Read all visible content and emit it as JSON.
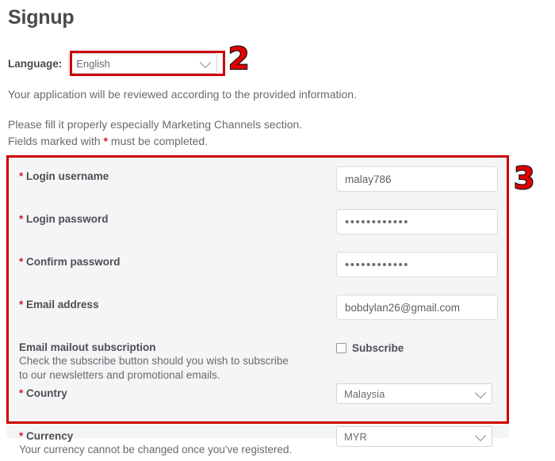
{
  "page": {
    "title": "Signup"
  },
  "language": {
    "label": "Language:",
    "value": "English"
  },
  "intro": {
    "review": "Your application will be reviewed according to the provided information.",
    "fill": "Please fill it properly especially Marketing Channels section.",
    "fields_prefix": "Fields marked with ",
    "fields_star": "*",
    "fields_suffix": " must be completed."
  },
  "annotations": {
    "step_two": "2",
    "step_three": "3",
    "color": "#cc0000"
  },
  "form": {
    "fields": [
      {
        "label": "Login username",
        "required_marker": "*",
        "value": "malay786",
        "type": "text"
      },
      {
        "label": "Login password",
        "required_marker": "*",
        "value": "••••••••••••",
        "type": "password"
      },
      {
        "label": "Confirm password",
        "required_marker": "*",
        "value": "••••••••••••",
        "type": "password"
      },
      {
        "label": "Email address",
        "required_marker": "*",
        "value": "bobdylan26@gmail.com",
        "type": "email"
      }
    ],
    "subscription": {
      "label": "Email mailout subscription",
      "note_line1": "Check the subscribe button should you wish to subscribe",
      "note_line2": "to our newsletters and promotional emails.",
      "checkbox_label": "Subscribe",
      "checked": false
    },
    "country": {
      "label": "Country",
      "required_marker": "*",
      "value": "Malaysia"
    },
    "currency": {
      "label": "Currency",
      "required_marker": "*",
      "note": "Your currency cannot be changed once you've registered.",
      "value": "MYR"
    }
  }
}
